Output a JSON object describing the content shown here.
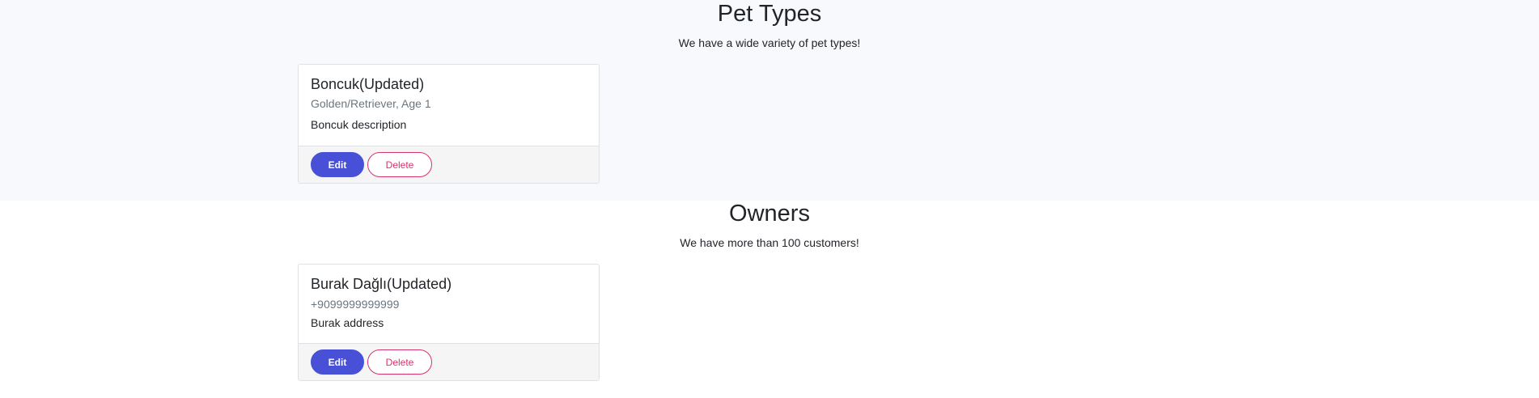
{
  "pet_types": {
    "title": "Pet Types",
    "subtitle": "We have a wide variety of pet types!",
    "cards": [
      {
        "title": "Boncuk(Updated)",
        "subtitle": "Golden/Retriever, Age 1",
        "text": "Boncuk description",
        "edit_label": "Edit",
        "delete_label": "Delete"
      }
    ]
  },
  "owners": {
    "title": "Owners",
    "subtitle": "We have more than 100 customers!",
    "cards": [
      {
        "title": "Burak Dağlı(Updated)",
        "subtitle": "+9099999999999",
        "text": "Burak address",
        "edit_label": "Edit",
        "delete_label": "Delete"
      }
    ]
  },
  "colors": {
    "primary": "#4850d8",
    "danger": "#d6336c",
    "section_bg": "#f8f9fc",
    "footer_bg": "#f5f5f5"
  }
}
